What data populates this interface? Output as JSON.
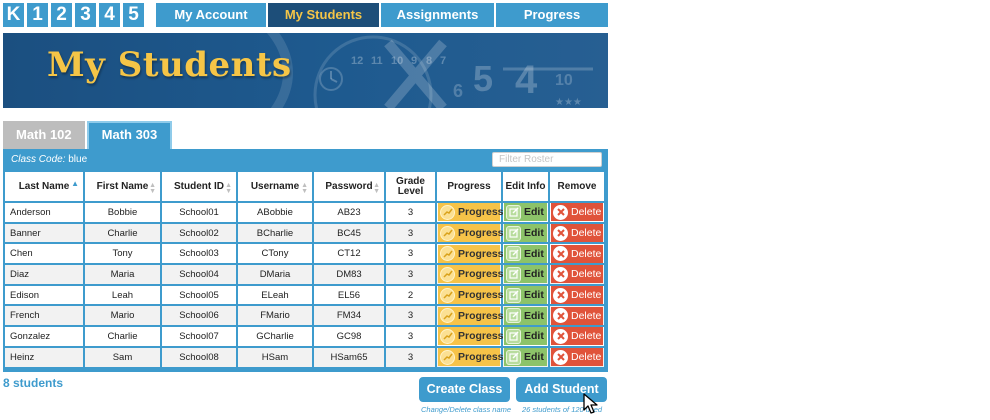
{
  "grades": [
    "K",
    "1",
    "2",
    "3",
    "4",
    "5"
  ],
  "nav_tabs": [
    {
      "label": "My Account",
      "active": false
    },
    {
      "label": "My Students",
      "active": true
    },
    {
      "label": "Assignments",
      "active": false
    },
    {
      "label": "Progress",
      "active": false
    }
  ],
  "banner": {
    "title": "My Students",
    "decor_numbers": [
      "12",
      "11",
      "10",
      "9",
      "8",
      "7",
      "6",
      "5",
      "4",
      "10"
    ]
  },
  "class_tabs": [
    {
      "label": "Math 102",
      "active": false
    },
    {
      "label": "Math 303",
      "active": true
    }
  ],
  "roster": {
    "class_code_label": "Class Code:",
    "class_code": "blue",
    "filter_placeholder": "Filter Roster",
    "columns": [
      "Last Name",
      "First Name",
      "Student ID",
      "Username",
      "Password",
      "Grade Level",
      "Progress",
      "Edit Info",
      "Remove"
    ],
    "sorted_column": "Last Name",
    "progress_label": "Progress",
    "edit_label": "Edit",
    "delete_label": "Delete",
    "rows": [
      {
        "last": "Anderson",
        "first": "Bobbie",
        "id": "School01",
        "user": "ABobbie",
        "pass": "AB23",
        "grade": "3"
      },
      {
        "last": "Banner",
        "first": "Charlie",
        "id": "School02",
        "user": "BCharlie",
        "pass": "BC45",
        "grade": "3"
      },
      {
        "last": "Chen",
        "first": "Tony",
        "id": "School03",
        "user": "CTony",
        "pass": "CT12",
        "grade": "3"
      },
      {
        "last": "Diaz",
        "first": "Maria",
        "id": "School04",
        "user": "DMaria",
        "pass": "DM83",
        "grade": "3"
      },
      {
        "last": "Edison",
        "first": "Leah",
        "id": "School05",
        "user": "ELeah",
        "pass": "EL56",
        "grade": "2"
      },
      {
        "last": "French",
        "first": "Mario",
        "id": "School06",
        "user": "FMario",
        "pass": "FM34",
        "grade": "3"
      },
      {
        "last": "Gonzalez",
        "first": "Charlie",
        "id": "School07",
        "user": "GCharlie",
        "pass": "GC98",
        "grade": "3"
      },
      {
        "last": "Heinz",
        "first": "Sam",
        "id": "School08",
        "user": "HSam",
        "pass": "HSam65",
        "grade": "3"
      }
    ]
  },
  "footer": {
    "student_count": "8 students",
    "create_class_label": "Create Class",
    "create_class_caption": "Change/Delete class name",
    "add_student_label": "Add Student",
    "add_student_caption": "26 students of 120 used"
  },
  "colors": {
    "primary": "#3e9bcd",
    "nav_active": "#1d4e79",
    "accent_gold": "#f5c547",
    "progress_yellow": "#f6c348",
    "edit_green": "#8cc369",
    "delete_red": "#e0533a"
  }
}
